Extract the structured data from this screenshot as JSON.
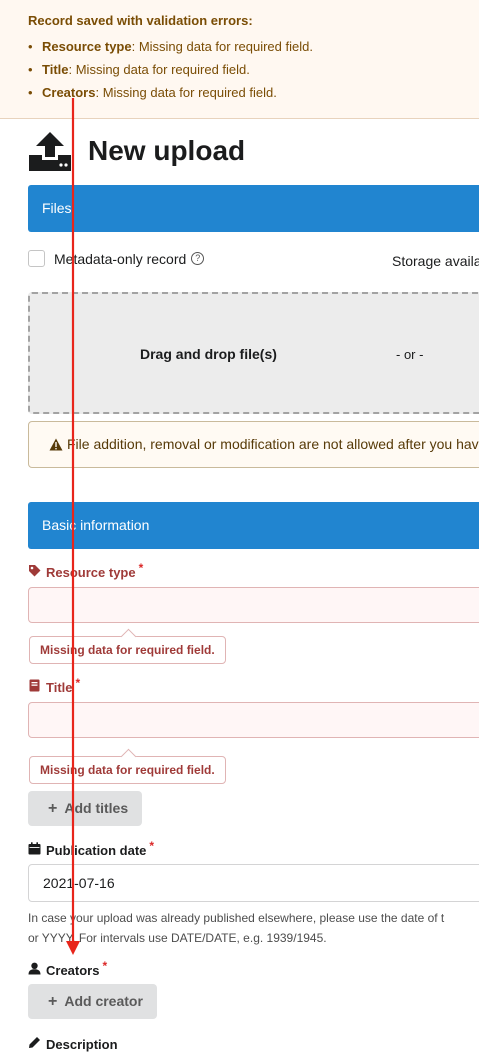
{
  "banner": {
    "title": "Record saved with validation errors:",
    "bullet": "•",
    "errors": [
      {
        "field": "Resource type",
        "message": ": Missing data for required field."
      },
      {
        "field": "Title",
        "message": ": Missing data for required field."
      },
      {
        "field": "Creators",
        "message": ": Missing data for required field."
      }
    ]
  },
  "header": {
    "title": "New upload",
    "icon": "upload-icon"
  },
  "files": {
    "section_title": "Files",
    "metadata_only_label": "Metadata-only record",
    "help_glyph": "?",
    "storage_text": "Storage availa",
    "drag_drop": "Drag and drop file(s)",
    "or_text": "- or -",
    "warning": "File addition, removal or modification are not allowed after you hav"
  },
  "basic": {
    "section_title": "Basic information",
    "required_mark": "*",
    "resource_type": {
      "label": "Resource type",
      "error": "Missing data for required field.",
      "icon": "tag-icon"
    },
    "title": {
      "label": "Title",
      "error": "Missing data for required field.",
      "icon": "book-icon",
      "add_label": "Add titles"
    },
    "publication_date": {
      "label": "Publication date",
      "value": "2021-07-16",
      "icon": "calendar-icon",
      "help_line1": "In case your upload was already published elsewhere, please use the date of t",
      "help_line2": "or YYYY. For intervals use DATE/DATE, e.g. 1939/1945."
    },
    "creators": {
      "label": "Creators",
      "add_label": "Add creator",
      "icon": "user-icon"
    },
    "description": {
      "label": "Description",
      "icon": "pencil-icon"
    }
  },
  "plus_glyph": "+",
  "colors": {
    "primary": "#2185d0",
    "error": "#9f3a38",
    "annotation_arrow": "#e8251b"
  }
}
